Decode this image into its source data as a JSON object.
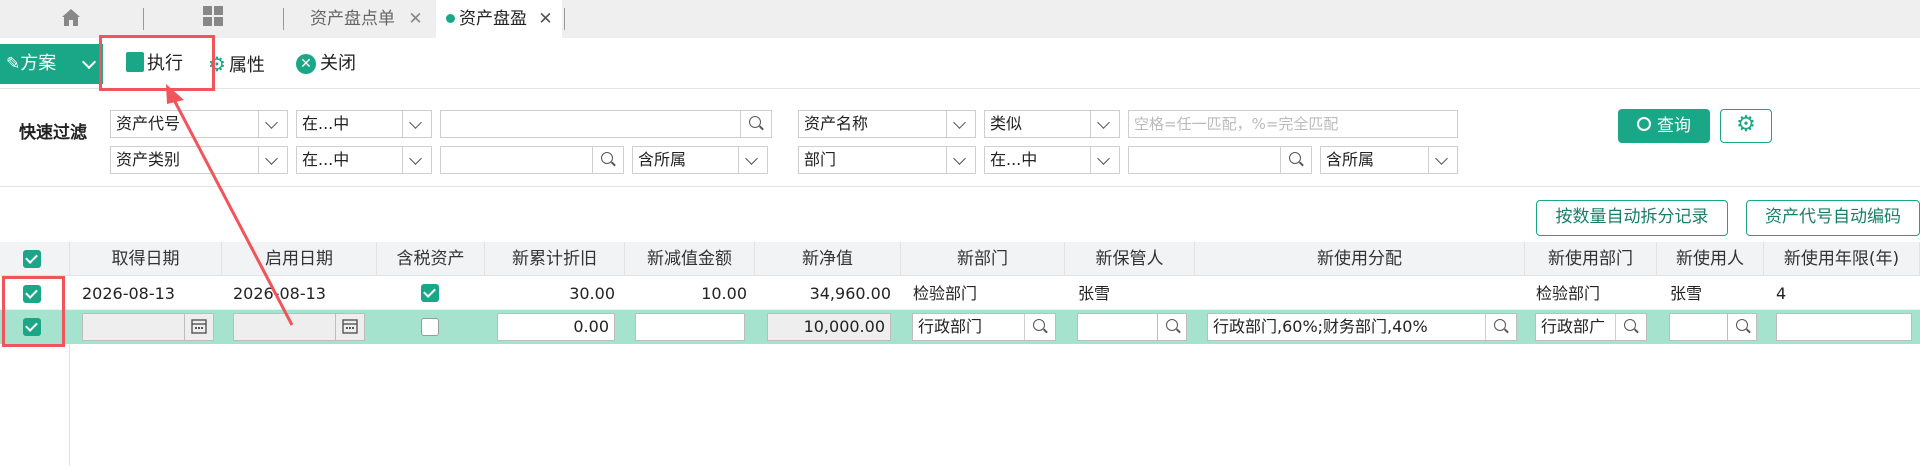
{
  "tabs": {
    "home": "home-icon",
    "apps": "grid-icon",
    "t1": "资产盘点单",
    "t2": "资产盘盈"
  },
  "toolbar": {
    "scheme": "方案",
    "execute": "执行",
    "props": "属性",
    "close": "关闭"
  },
  "filter": {
    "label": "快速过滤",
    "r1": {
      "f1": "资产代号",
      "o1": "在...中",
      "f2": "资产名称",
      "o2": "类似",
      "placeholder": "空格=任一匹配，%=完全匹配"
    },
    "r2": {
      "f1": "资产类别",
      "o1": "在...中",
      "inc1": "含所属",
      "f2": "部门",
      "o2": "在...中",
      "inc2": "含所属"
    },
    "query": "查询"
  },
  "actions": {
    "split": "按数量自动拆分记录",
    "autocode": "资产代号自动编码"
  },
  "columns": [
    "取得日期",
    "启用日期",
    "含税资产",
    "新累计折旧",
    "新减值金额",
    "新净值",
    "新部门",
    "新保管人",
    "新使用分配",
    "新使用部门",
    "新使用人",
    "新使用年限(年)"
  ],
  "rows": [
    {
      "acquire": "2026-08-13",
      "start": "2026-08-13",
      "taxed": true,
      "dep": "30.00",
      "impair": "10.00",
      "net": "34,960.00",
      "dept": "检验部门",
      "keeper": "张雪",
      "alloc": "",
      "use_dept": "检验部门",
      "user": "张雪",
      "years": "4"
    },
    {
      "acquire": "",
      "start": "",
      "taxed": false,
      "dep": "0.00",
      "impair": "",
      "net": "10,000.00",
      "dept": "行政部门",
      "keeper": "",
      "alloc": "行政部门,60%;财务部门,40%",
      "use_dept": "行政部广",
      "user": "",
      "years": ""
    }
  ],
  "colors": {
    "accent": "#1aa787",
    "highlight": "#f0555b",
    "row_selected": "#a6e3cf"
  }
}
